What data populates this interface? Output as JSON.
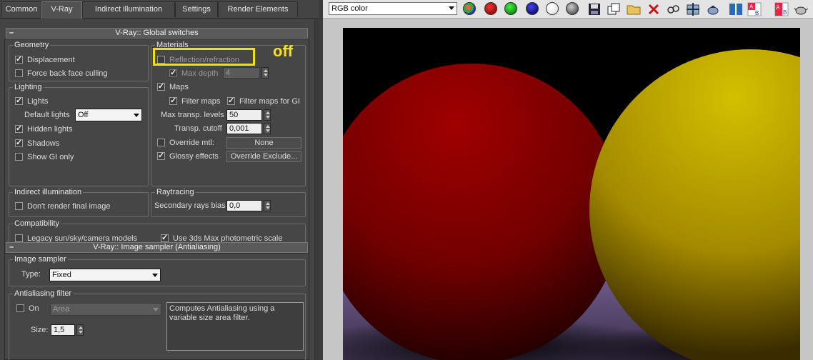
{
  "tabs": [
    "Common",
    "V-Ray",
    "Indirect illumination",
    "Settings",
    "Render Elements"
  ],
  "global_switches": {
    "title": "V-Ray:: Global switches",
    "geometry": {
      "label": "Geometry",
      "displacement": "Displacement",
      "force_back_face_culling": "Force back face culling"
    },
    "lighting": {
      "label": "Lighting",
      "lights": "Lights",
      "default_lights_label": "Default lights",
      "default_lights_value": "Off",
      "hidden_lights": "Hidden lights",
      "shadows": "Shadows",
      "show_gi_only": "Show GI only"
    },
    "materials": {
      "label": "Materials",
      "reflection_refraction": "Reflection/refraction",
      "max_depth_label": "Max depth",
      "max_depth_value": "4",
      "maps": "Maps",
      "filter_maps": "Filter maps",
      "filter_maps_for_gi": "Filter maps for GI",
      "max_transp_levels_label": "Max transp. levels",
      "max_transp_levels_value": "50",
      "transp_cutoff_label": "Transp. cutoff",
      "transp_cutoff_value": "0,001",
      "override_mtl": "Override mtl:",
      "override_mtl_button": "None",
      "glossy_effects": "Glossy effects",
      "override_exclude_button": "Override Exclude..."
    },
    "indirect_illumination": {
      "label": "Indirect illumination",
      "dont_render_final_image": "Don't render final image"
    },
    "raytracing": {
      "label": "Raytracing",
      "secondary_rays_bias_label": "Secondary rays bias",
      "secondary_rays_bias_value": "0,0"
    },
    "compatibility": {
      "label": "Compatibility",
      "legacy_sun_sky_camera": "Legacy sun/sky/camera models",
      "use_3ds_max_photometric_scale": "Use 3ds Max photometric scale"
    }
  },
  "annotation": {
    "text": "off",
    "color": "#f3e100"
  },
  "image_sampler": {
    "title": "V-Ray:: Image sampler (Antialiasing)",
    "group_label": "Image sampler",
    "type_label": "Type:",
    "type_value": "Fixed",
    "aa_filter_label": "Antialiasing filter",
    "on_label": "On",
    "filter_value": "Area",
    "description": "Computes Antialiasing using a variable size area filter.",
    "size_label": "Size:",
    "size_value": "1,5"
  },
  "frame_buffer": {
    "channel": "RGB color",
    "colors": {
      "red_sphere": "#8a0000",
      "yellow_sphere": "#c8b400",
      "floor": "#6e5a8a"
    }
  }
}
